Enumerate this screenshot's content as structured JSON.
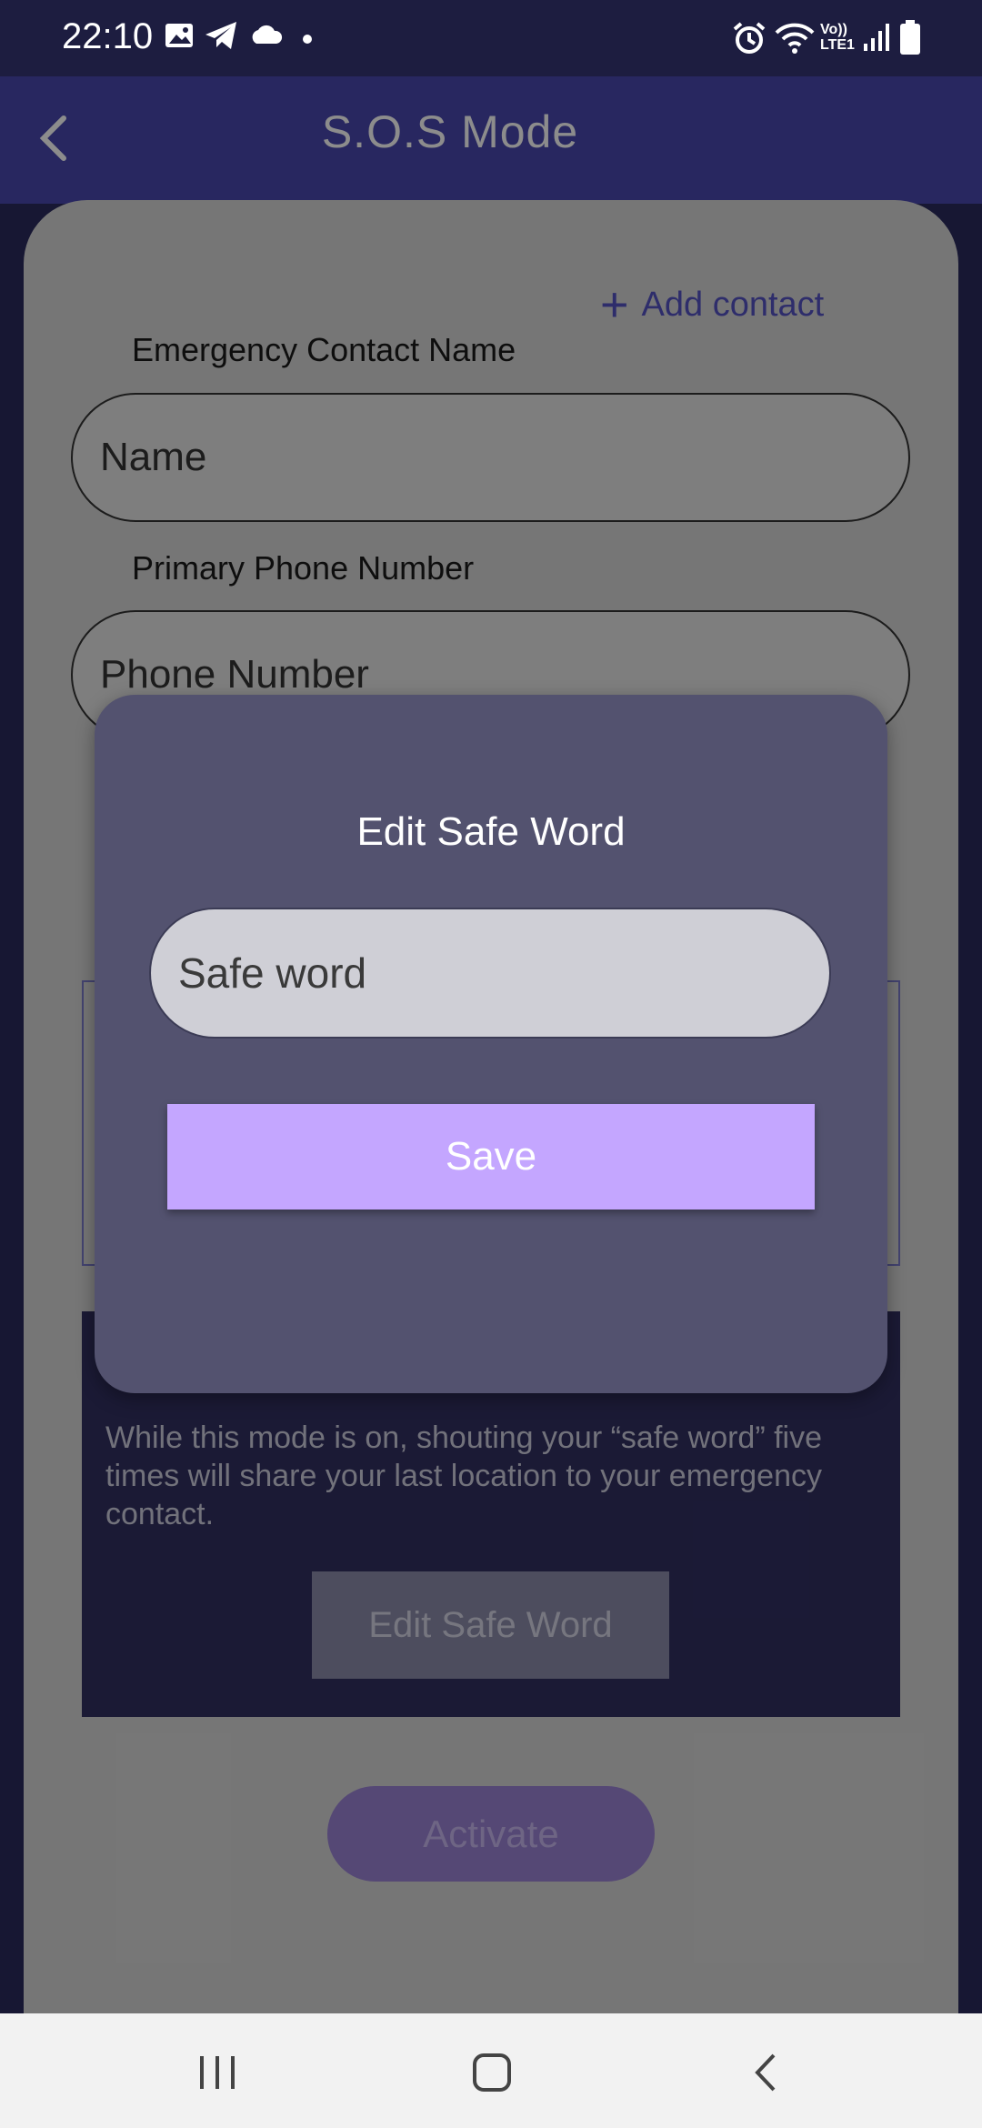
{
  "status_bar": {
    "time": "22:10",
    "left_icons": [
      "image-icon",
      "telegram-icon",
      "cloud-icon",
      "dot-icon"
    ],
    "right_icons": [
      "alarm-icon",
      "wifi-icon",
      "volte-icon",
      "signal-icon",
      "battery-icon"
    ],
    "volte_text": "Vo))",
    "lte_text": "LTE1"
  },
  "header": {
    "title": "S.O.S Mode"
  },
  "form": {
    "add_contact_label": "Add contact",
    "name_label": "Emergency Contact Name",
    "name_placeholder": "Name",
    "phone_label": "Primary Phone Number",
    "phone_placeholder": "Phone Number"
  },
  "safe_word_section": {
    "description": "While this mode is on, shouting your “safe word” five times will share your last location to your emergency contact.",
    "edit_button": "Edit Safe Word"
  },
  "activate_button": "Activate",
  "dialog": {
    "title": "Edit Safe Word",
    "input_placeholder": "Safe word",
    "save_button": "Save"
  },
  "colors": {
    "accent": "#c4a6ff",
    "header": "#4a47b0",
    "dialog": "#53526f"
  }
}
